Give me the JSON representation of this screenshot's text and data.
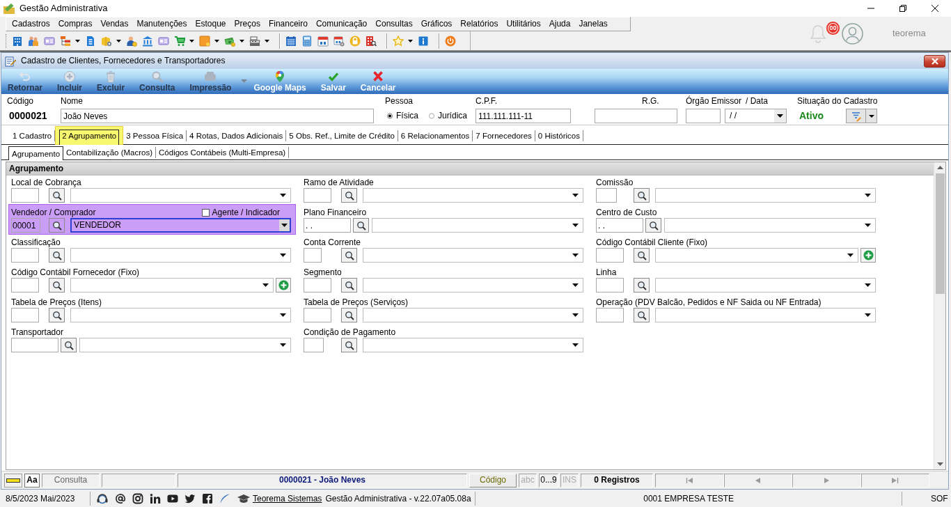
{
  "window": {
    "title": "Gestão Administrativa"
  },
  "menu": [
    "Cadastros",
    "Compras",
    "Vendas",
    "Manutenções",
    "Estoque",
    "Preços",
    "Financeiro",
    "Comunicação",
    "Consultas",
    "Gráficos",
    "Relatórios",
    "Utilitários",
    "Ajuda",
    "Janelas"
  ],
  "notifications": {
    "count": "00"
  },
  "user": {
    "name": "teorema"
  },
  "dialog": {
    "title": "Cadastro de Clientes, Fornecedores e Transportadores",
    "toolbar": [
      {
        "label": "Retornar",
        "disabled": true,
        "menu": false
      },
      {
        "label": "Incluir",
        "disabled": true,
        "menu": false
      },
      {
        "label": "Excluir",
        "disabled": true,
        "menu": false
      },
      {
        "label": "Consulta",
        "disabled": true,
        "menu": false
      },
      {
        "label": "Impressão",
        "disabled": true,
        "menu": true
      },
      {
        "label": "Google Maps",
        "disabled": false,
        "menu": false
      },
      {
        "label": "Salvar",
        "disabled": false,
        "menu": false
      },
      {
        "label": "Cancelar",
        "disabled": false,
        "menu": false
      }
    ],
    "record": {
      "code_label": "Código",
      "code": "0000021",
      "name_label": "Nome",
      "name": "João Neves",
      "person_label": "Pessoa",
      "person_types": [
        {
          "label": "Física",
          "selected": true
        },
        {
          "label": "Jurídica",
          "selected": false
        }
      ],
      "cpf_label": "C.P.F.",
      "cpf": "111.111.111-11",
      "rg_label": "R.G.",
      "issuer_label": "Órgão Emissor",
      "date_label": "/ Data",
      "date": "/ /",
      "status_label": "Situação do Cadastro",
      "status": "Ativo"
    },
    "tabs": [
      {
        "label": "1 Cadastro",
        "selected": false
      },
      {
        "label": "2 Agrupamento",
        "selected": true
      },
      {
        "label": "3 Pessoa Física",
        "selected": false
      },
      {
        "label": "4 Rotas, Dados Adicionais",
        "selected": false
      },
      {
        "label": "5 Obs. Ref., Limite de Crédito",
        "selected": false
      },
      {
        "label": "6 Relacionamentos",
        "selected": false
      },
      {
        "label": "7 Fornecedores",
        "selected": false
      },
      {
        "label": "0 Históricos",
        "selected": false
      }
    ],
    "subtabs": [
      {
        "label": "Agrupamento",
        "selected": true
      },
      {
        "label": "Contabilização (Macros)",
        "selected": false
      },
      {
        "label": "Códigos Contábeis (Multi-Empresa)",
        "selected": false
      }
    ],
    "panel": {
      "title": "Agrupamento",
      "fields": [
        {
          "label": "Local de Cobrança",
          "kind": "lookup",
          "focused": false
        },
        {
          "label": "Ramo de Atividade",
          "kind": "lookup",
          "focused": false
        },
        {
          "label": "Comissão",
          "kind": "lookup",
          "focused": false
        },
        {
          "label": "Vendedor / Comprador",
          "kind": "lookup",
          "focused": true,
          "code": "00001",
          "value": "VENDEDOR",
          "option": {
            "label": "Agente / Indicador",
            "checked": false
          }
        },
        {
          "label": "Plano Financeiro",
          "kind": "lookup",
          "focused": false,
          "code": ". ."
        },
        {
          "label": "Centro de Custo",
          "kind": "lookup",
          "focused": false,
          "code": ". ."
        },
        {
          "label": "Classificação",
          "kind": "lookup",
          "focused": false
        },
        {
          "label": "Conta Corrente",
          "kind": "lookup",
          "focused": false
        },
        {
          "label": "Código Contábil Cliente (Fixo)",
          "kind": "lookup-add",
          "focused": false
        },
        {
          "label": "Código Contábil Fornecedor (Fixo)",
          "kind": "lookup-add",
          "focused": false
        },
        {
          "label": "Segmento",
          "kind": "lookup",
          "focused": false
        },
        {
          "label": "Linha",
          "kind": "lookup",
          "focused": false
        },
        {
          "label": "Tabela de Preços (Itens)",
          "kind": "lookup",
          "focused": false
        },
        {
          "label": "Tabela de Preços (Serviços)",
          "kind": "lookup",
          "focused": false
        },
        {
          "label": "Operação (PDV Balcão, Pedidos e NF Saida ou NF Entrada)",
          "kind": "lookup",
          "focused": false
        },
        {
          "label": "Transportador",
          "kind": "lookup",
          "focused": false
        },
        {
          "label": "Condição de Pagamento",
          "kind": "lookup",
          "focused": false
        }
      ]
    }
  },
  "status_bar": {
    "font_button": "Aa",
    "mode": "Consulta",
    "record": "0000021 - João Neves",
    "search_field": "Código",
    "indicators": [
      {
        "label": "abc",
        "on": false
      },
      {
        "label": "0...9",
        "on": true
      },
      {
        "label": "INS",
        "on": false
      }
    ],
    "count": "0 Registros"
  },
  "footer": {
    "date": "8/5/2023 Mai/2023",
    "link": "Teorema Sistemas",
    "version": "Gestão Administrativa - v.22.07a05.08a",
    "company": "0001 EMPRESA TESTE",
    "user": "SOF"
  }
}
